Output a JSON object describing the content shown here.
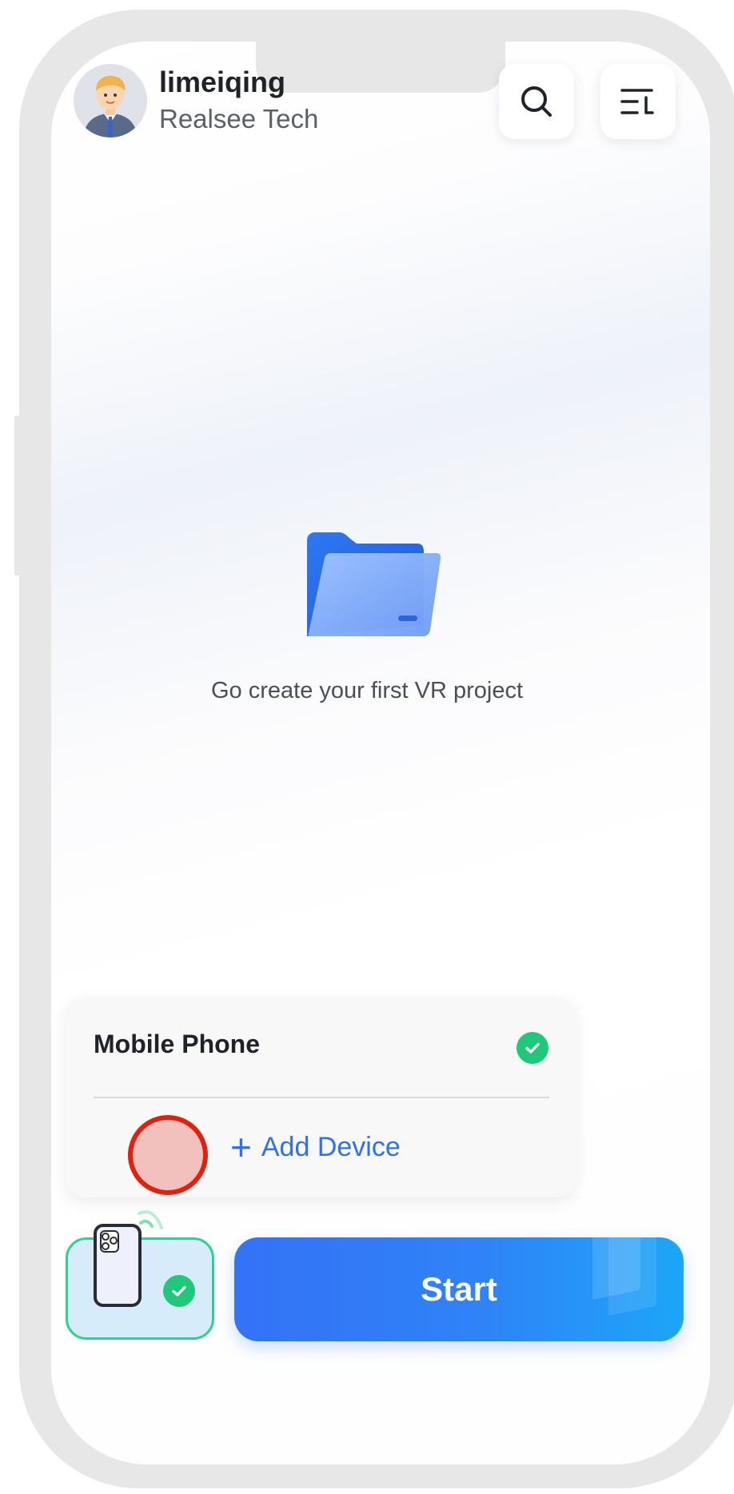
{
  "header": {
    "user_name": "limeiqing",
    "organization": "Realsee Tech"
  },
  "empty_state": {
    "message": "Go create your first VR project"
  },
  "device_popup": {
    "device_name": "Mobile Phone",
    "add_device_label": "Add Device",
    "add_device_prefix": "+"
  },
  "bottom_bar": {
    "start_label": "Start"
  },
  "colors": {
    "primary_blue": "#2f6ff2",
    "success_green": "#20c97a",
    "frame_gray": "#e7e7e7"
  },
  "icons": [
    "search-icon",
    "sort-icon",
    "folder-icon",
    "check-icon",
    "phone-icon",
    "signal-icon"
  ]
}
